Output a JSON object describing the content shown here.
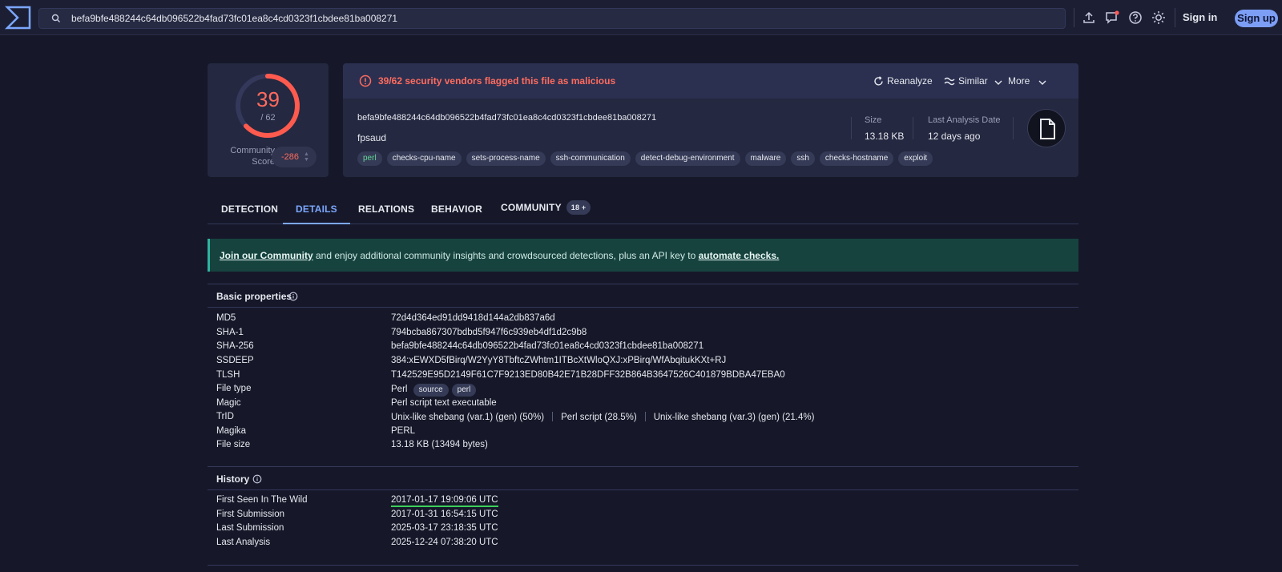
{
  "search": {
    "value": "befa9bfe488244c64db096522b4fad73fc01ea8c4cd0323f1cbdee81ba008271"
  },
  "topbar": {
    "signin_label": "Sign in",
    "signup_label": "Sign up"
  },
  "score": {
    "detections": "39",
    "total": "/ 62",
    "fraction": 0.629,
    "community_label_1": "Community",
    "community_label_2": "Score",
    "community_value": "-286"
  },
  "summary": {
    "alert": "39/62 security vendors flagged this file as malicious",
    "reanalyze_label": "Reanalyze",
    "similar_label": "Similar",
    "more_label": "More",
    "hash": "befa9bfe488244c64db096522b4fad73fc01ea8c4cd0323f1cbdee81ba008271",
    "filename": "fpsaud",
    "tags": [
      "perl",
      "checks-cpu-name",
      "sets-process-name",
      "ssh-communication",
      "detect-debug-environment",
      "malware",
      "ssh",
      "checks-hostname",
      "exploit"
    ],
    "size_label": "Size",
    "size_value": "13.18 KB",
    "date_label": "Last Analysis Date",
    "date_value": "12 days ago"
  },
  "tabs": [
    {
      "label": "DETECTION"
    },
    {
      "label": "DETAILS"
    },
    {
      "label": "RELATIONS"
    },
    {
      "label": "BEHAVIOR"
    },
    {
      "label": "COMMUNITY",
      "badge": "18 +"
    }
  ],
  "banner": {
    "link1": "Join our Community",
    "text": " and enjoy additional community insights and crowdsourced detections, plus an API key to ",
    "link2": "automate checks."
  },
  "basic": {
    "title": "Basic properties",
    "md5_k": "MD5",
    "md5_v": "72d4d364ed91dd9418d144a2db837a6d",
    "sha1_k": "SHA-1",
    "sha1_v": "794bcba867307bdbd5f947f6c939eb4df1d2c9b8",
    "sha256_k": "SHA-256",
    "sha256_v": "befa9bfe488244c64db096522b4fad73fc01ea8c4cd0323f1cbdee81ba008271",
    "ssdeep_k": "SSDEEP",
    "ssdeep_v": "384:xEWXD5fBirq/W2YyY8TbftcZWhtm1ITBcXtWloQXJ:xPBirq/WfAbqitukKXt+RJ",
    "tlsh_k": "TLSH",
    "tlsh_v": "T142529E95D2149F61C7F9213ED80B42E71B28DFF32B864B3647526C401879BDBA47EBA0",
    "filetype_k": "File type",
    "filetype_v": "Perl",
    "filetype_pill1": "source",
    "filetype_pill2": "perl",
    "magic_k": "Magic",
    "magic_v": "Perl script text executable",
    "trid_k": "TrID",
    "trid_v1": "Unix-like shebang (var.1) (gen) (50%)",
    "trid_v2": "Perl script (28.5%)",
    "trid_v3": "Unix-like shebang (var.3) (gen) (21.4%)",
    "magika_k": "Magika",
    "magika_v": "PERL",
    "filesize_k": "File size",
    "filesize_v": "13.18 KB (13494 bytes)"
  },
  "history": {
    "title": "History",
    "first_seen_k": "First Seen In The Wild",
    "first_seen_v": "2017-01-17 19:09:06 UTC",
    "first_sub_k": "First Submission",
    "first_sub_v": "2017-01-31 16:54:15 UTC",
    "last_sub_k": "Last Submission",
    "last_sub_v": "2025-03-17 23:18:35 UTC",
    "last_an_k": "Last Analysis",
    "last_an_v": "2025-12-24 07:38:20 UTC"
  },
  "colors": {
    "accent": "#7ca7ff",
    "danger": "#ff6b5e",
    "banner": "#17433f"
  }
}
